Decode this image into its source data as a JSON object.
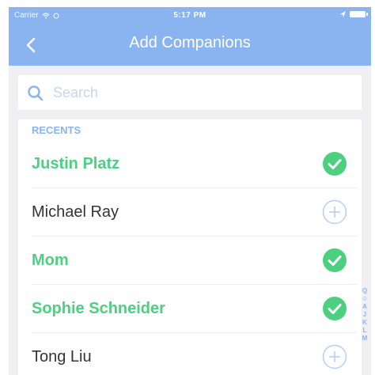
{
  "status_bar": {
    "carrier": "Carrier",
    "time": "5:17 PM"
  },
  "nav": {
    "title": "Add Companions"
  },
  "search": {
    "placeholder": "Search"
  },
  "section": {
    "header": "RECENTS"
  },
  "contacts": [
    {
      "name": "Justin Platz",
      "status": "added"
    },
    {
      "name": "Michael Ray",
      "status": "not_added"
    },
    {
      "name": "Mom",
      "status": "added"
    },
    {
      "name": "Sophie Schneider",
      "status": "added"
    },
    {
      "name": "Tong Liu",
      "status": "not_added"
    }
  ],
  "index_bar": [
    "Q",
    "☺",
    "A",
    "J",
    "K",
    "L",
    "M"
  ],
  "colors": {
    "header_bg": "#8ab4f0",
    "accent": "#4cd07f",
    "link": "#8ab4f0"
  }
}
